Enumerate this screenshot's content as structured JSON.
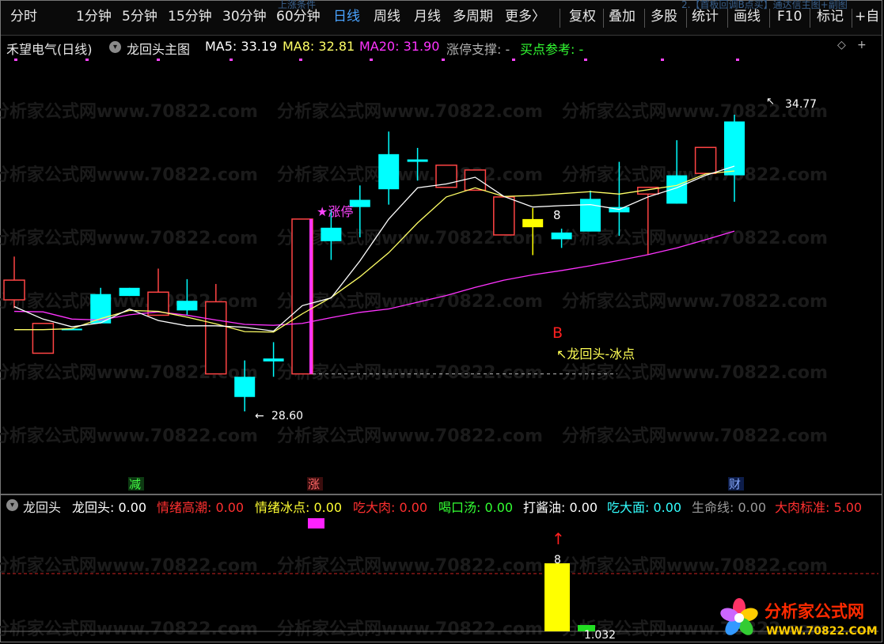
{
  "toolbar": {
    "periods": [
      "分时",
      "1分钟",
      "5分钟",
      "15分钟",
      "30分钟",
      "60分钟",
      "日线",
      "周线",
      "月线",
      "多周期",
      "更多〉"
    ],
    "active_period": "日线",
    "actions": [
      "复权",
      "叠加",
      "多股",
      "统计",
      "画线",
      "F10",
      "标记",
      "+自"
    ]
  },
  "background_text": {
    "top_left": "上涨条件",
    "top_right": "2.【首板回调B点买】通达信主图+副图"
  },
  "main_panel": {
    "stock_title": "禾望电气(日线)",
    "formula_name": "龙回头主图",
    "ma5_label": "MA5: 33.19",
    "ma8_label": "MA8: 32.81",
    "ma20_label": "MA20: 31.90",
    "support_label": "涨停支撑: -",
    "buy_ref_label": "买点参考: -",
    "colors": {
      "ma5": "#ffffff",
      "ma8": "#ffff66",
      "ma20": "#ff33ff",
      "up": "#ff4444",
      "down": "#00ffff",
      "signal": "#ffff00"
    }
  },
  "watermark": "分析家公式网www.70822.com",
  "annotations": {
    "high": "34.77",
    "low": "28.60",
    "limit_up": "★涨停",
    "count": "8",
    "b_point": "B",
    "dragon_note": "↖龙回头-冰点"
  },
  "event_labels": {
    "reduce": "减",
    "limit": "涨",
    "finance": "财"
  },
  "indicator": {
    "name": "龙回头",
    "items": [
      {
        "text": "龙回头: 0.00",
        "color": "#ffffff"
      },
      {
        "text": "情绪高潮: 0.00",
        "color": "#ff3030"
      },
      {
        "text": "情绪冰点: 0.00",
        "color": "#ffff33"
      },
      {
        "text": "吃大肉: 0.00",
        "color": "#ff3030"
      },
      {
        "text": "喝口汤: 0.00",
        "color": "#33ff33"
      },
      {
        "text": "打酱油: 0.00",
        "color": "#ffffff"
      },
      {
        "text": "吃大面: 0.00",
        "color": "#33ffff"
      },
      {
        "text": "生命线: 0.00",
        "color": "#9a9a9a"
      },
      {
        "text": "大肉标准: 5.00",
        "color": "#ff3030"
      }
    ],
    "bar_label": "8",
    "value_label": "1.032"
  },
  "logo": {
    "text": "分析家公式网",
    "url": "WWW.70822.COM"
  },
  "chart_data": {
    "type": "candlestick",
    "candles": [
      {
        "o": 31.33,
        "h": 31.82,
        "c": 30.92,
        "l": 30.75
      },
      {
        "o": 30.43,
        "h": 30.43,
        "c": 29.81,
        "l": 29.81
      },
      {
        "o": 30.32,
        "h": 30.32,
        "c": 30.32,
        "l": 30.32
      },
      {
        "o": 30.43,
        "h": 31.17,
        "c": 31.04,
        "l": 30.43
      },
      {
        "o": 31.0,
        "h": 31.17,
        "c": 31.17,
        "l": 31.0
      },
      {
        "o": 31.08,
        "h": 31.57,
        "c": 30.6,
        "l": 30.6
      },
      {
        "o": 30.7,
        "h": 31.35,
        "c": 30.9,
        "l": 30.6
      },
      {
        "o": 30.88,
        "h": 31.25,
        "c": 29.38,
        "l": 29.38
      },
      {
        "o": 28.9,
        "h": 29.66,
        "c": 29.32,
        "l": 28.6
      },
      {
        "o": 29.64,
        "h": 30.04,
        "c": 29.7,
        "l": 29.32
      },
      {
        "o": 32.6,
        "h": 32.6,
        "c": 29.38,
        "l": 29.38
      },
      {
        "o": 32.14,
        "h": 32.8,
        "c": 32.42,
        "l": 31.75
      },
      {
        "o": 32.85,
        "h": 33.3,
        "c": 33.0,
        "l": 32.22
      },
      {
        "o": 33.22,
        "h": 34.42,
        "c": 33.95,
        "l": 32.9
      },
      {
        "o": 33.79,
        "h": 34.08,
        "c": 33.84,
        "l": 33.4
      },
      {
        "o": 33.72,
        "h": 33.72,
        "c": 33.26,
        "l": 33.26
      },
      {
        "o": 33.62,
        "h": 33.62,
        "c": 33.2,
        "l": 33.2
      },
      {
        "o": 33.06,
        "h": 33.06,
        "c": 32.27,
        "l": 32.27
      },
      {
        "o": 32.6,
        "h": 32.83,
        "c": 32.43,
        "l": 31.85
      },
      {
        "o": 32.18,
        "h": 32.4,
        "c": 32.32,
        "l": 32.0
      },
      {
        "o": 32.34,
        "h": 33.19,
        "c": 33.02,
        "l": 32.6
      },
      {
        "o": 32.74,
        "h": 33.79,
        "c": 32.85,
        "l": 32.25
      },
      {
        "o": 33.26,
        "h": 33.26,
        "c": 33.12,
        "l": 31.86
      },
      {
        "o": 32.92,
        "h": 34.24,
        "c": 33.51,
        "l": 32.92
      },
      {
        "o": 34.09,
        "h": 34.09,
        "c": 33.55,
        "l": 33.55
      },
      {
        "o": 33.51,
        "h": 34.77,
        "c": 34.63,
        "l": 32.96
      }
    ],
    "signal_candle_index": 18,
    "ma5": [
      30.78,
      30.52,
      30.36,
      30.44,
      30.73,
      30.49,
      30.38,
      30.38,
      30.35,
      30.27,
      30.8,
      30.96,
      31.73,
      32.6,
      33.25,
      33.33,
      33.47,
      33.07,
      32.85,
      32.88,
      32.9,
      32.8,
      33.06,
      33.25,
      33.51,
      33.7
    ],
    "ma8": [
      30.3,
      30.3,
      30.32,
      30.53,
      30.7,
      30.68,
      30.56,
      30.42,
      30.26,
      30.25,
      30.63,
      30.97,
      31.4,
      31.9,
      32.52,
      33.06,
      33.25,
      33.07,
      33.09,
      33.13,
      33.17,
      33.12,
      33.21,
      33.3,
      33.54,
      33.6
    ],
    "ma20": [
      30.68,
      30.67,
      30.52,
      30.5,
      30.61,
      30.67,
      30.6,
      30.5,
      30.41,
      30.39,
      30.43,
      30.55,
      30.66,
      30.73,
      30.87,
      31.01,
      31.18,
      31.33,
      31.44,
      31.53,
      31.63,
      31.74,
      31.86,
      32.0,
      32.17,
      32.35
    ]
  }
}
